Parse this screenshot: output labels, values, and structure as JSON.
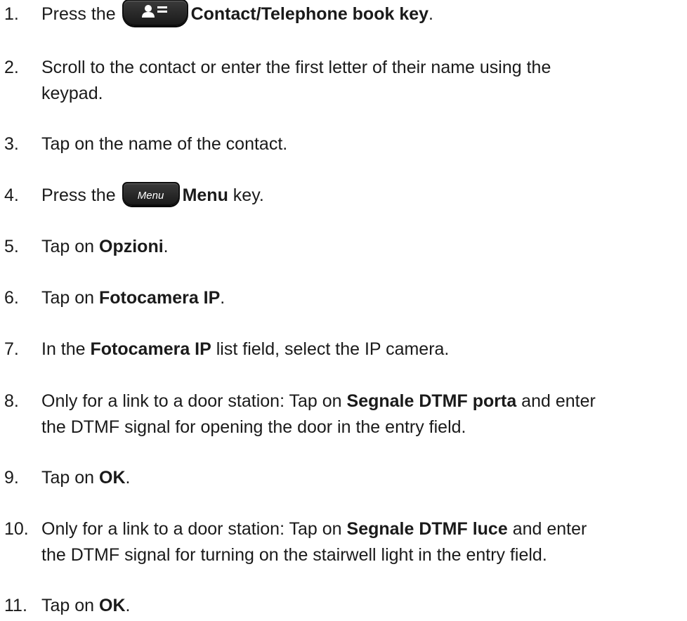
{
  "steps": [
    {
      "number": "1.",
      "prefix": "Press the",
      "icon": "contact-telephone-book-key-icon",
      "bold": "Contact/Telephone book key",
      "suffix": "."
    },
    {
      "number": "2.",
      "line1": "Scroll to the contact or enter the first letter of their name using the",
      "line2": "keypad."
    },
    {
      "number": "3.",
      "text": "Tap on the name of the contact."
    },
    {
      "number": "4.",
      "prefix": "Press the",
      "key_label": "Menu",
      "bold": "Menu",
      "suffix": "key."
    },
    {
      "number": "5.",
      "prefix": "Tap on",
      "bold": "Opzioni",
      "suffix": "."
    },
    {
      "number": "6.",
      "prefix": "Tap on",
      "bold": "Fotocamera IP",
      "suffix": "."
    },
    {
      "number": "7.",
      "prefix": "In the",
      "bold": "Fotocamera IP",
      "suffix": "list field, select the IP camera."
    },
    {
      "number": "8.",
      "prefix": "Only for a link to a door station: Tap on",
      "bold": "Segnale DTMF porta",
      "suffix": "and enter",
      "line2": "the DTMF signal for opening the door in the entry field."
    },
    {
      "number": "9.",
      "prefix": "Tap on",
      "bold": "OK",
      "suffix": "."
    },
    {
      "number": "10.",
      "prefix": "Only for a link to a door station: Tap on",
      "bold": "Segnale DTMF luce",
      "suffix": "and enter",
      "line2": "the DTMF signal for turning on the stairwell light in the entry field."
    },
    {
      "number": "11.",
      "prefix": "Tap on",
      "bold": "OK",
      "suffix": "."
    }
  ]
}
